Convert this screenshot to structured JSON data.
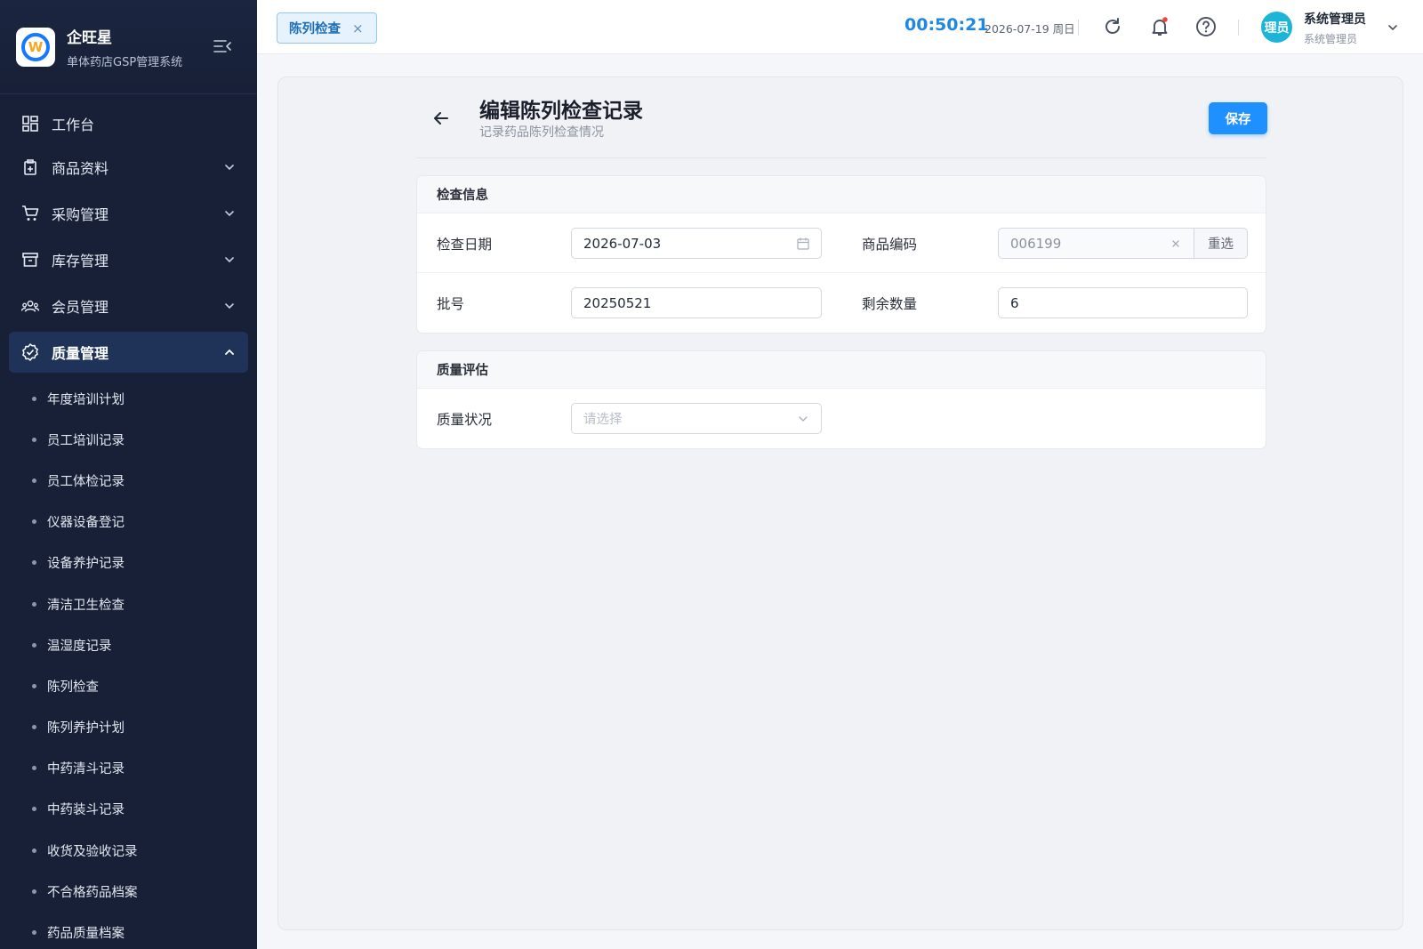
{
  "brand": {
    "title": "企旺星",
    "subtitle": "单体药店GSP管理系统"
  },
  "sidebar": {
    "items": [
      {
        "label": "工作台",
        "icon": "dashboard-icon"
      },
      {
        "label": "商品资料",
        "icon": "product-icon"
      },
      {
        "label": "采购管理",
        "icon": "cart-icon"
      },
      {
        "label": "库存管理",
        "icon": "archive-icon"
      },
      {
        "label": "会员管理",
        "icon": "members-icon"
      },
      {
        "label": "质量管理",
        "icon": "quality-icon",
        "active": true
      }
    ],
    "subitems": [
      "年度培训计划",
      "员工培训记录",
      "员工体检记录",
      "仪器设备登记",
      "设备养护记录",
      "清洁卫生检查",
      "温湿度记录",
      "陈列检查",
      "陈列养护计划",
      "中药清斗记录",
      "中药装斗记录",
      "收货及验收记录",
      "不合格药品档案",
      "药品质量档案"
    ]
  },
  "topbar": {
    "tab_label": "陈列检查",
    "tab_close": "×",
    "clock": "00:50:21",
    "date": "2026-07-19 周日",
    "avatar_text": "理员",
    "user_name": "系统管理员",
    "user_role": "系统管理员"
  },
  "page": {
    "title": "编辑陈列检查记录",
    "subtitle": "记录药品陈列检查情况",
    "save_label": "保存"
  },
  "inspection": {
    "section_title": "检查信息",
    "date_label": "检查日期",
    "date_value": "2026-07-03",
    "code_label": "商品编码",
    "code_value": "006199",
    "reset_label": "重选",
    "batch_label": "批号",
    "batch_value": "20250521",
    "qty_label": "剩余数量",
    "qty_value": "6"
  },
  "quality": {
    "section_title": "质量评估",
    "status_label": "质量状况",
    "status_placeholder": "请选择"
  },
  "colors": {
    "sidebar_bg": "#172036",
    "accent": "#1e90ff",
    "clock": "#1e88e5",
    "avatar": "#1cb5d8"
  }
}
